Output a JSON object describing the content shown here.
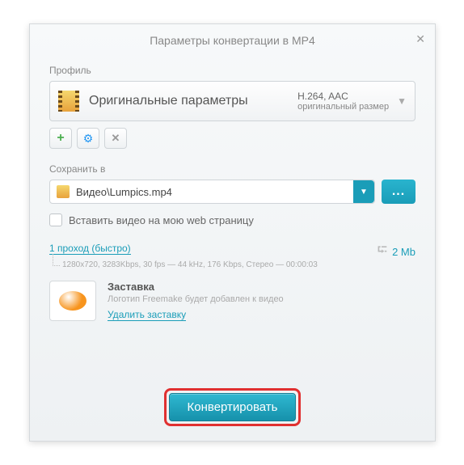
{
  "dialog": {
    "title": "Параметры конвертации в MP4",
    "profile_label": "Профиль",
    "profile_name": "Оригинальные параметры",
    "profile_codec": "H.264, AAC",
    "profile_size": "оригинальный размер",
    "save_label": "Сохранить в",
    "save_path": "Видео\\Lumpics.mp4",
    "embed_check": "Вставить видео на мою web страницу",
    "pass_link": "1 проход (быстро)",
    "pass_details": "1280x720, 3283Kbps, 30 fps — 44 kHz, 176 Kbps, Стерео — 00:00:03",
    "size_est": "2 Mb",
    "splash_title": "Заставка",
    "splash_desc": "Логотип Freemake будет добавлен к видео",
    "splash_remove": "Удалить заставку",
    "convert": "Конвертировать",
    "browse": "..."
  }
}
